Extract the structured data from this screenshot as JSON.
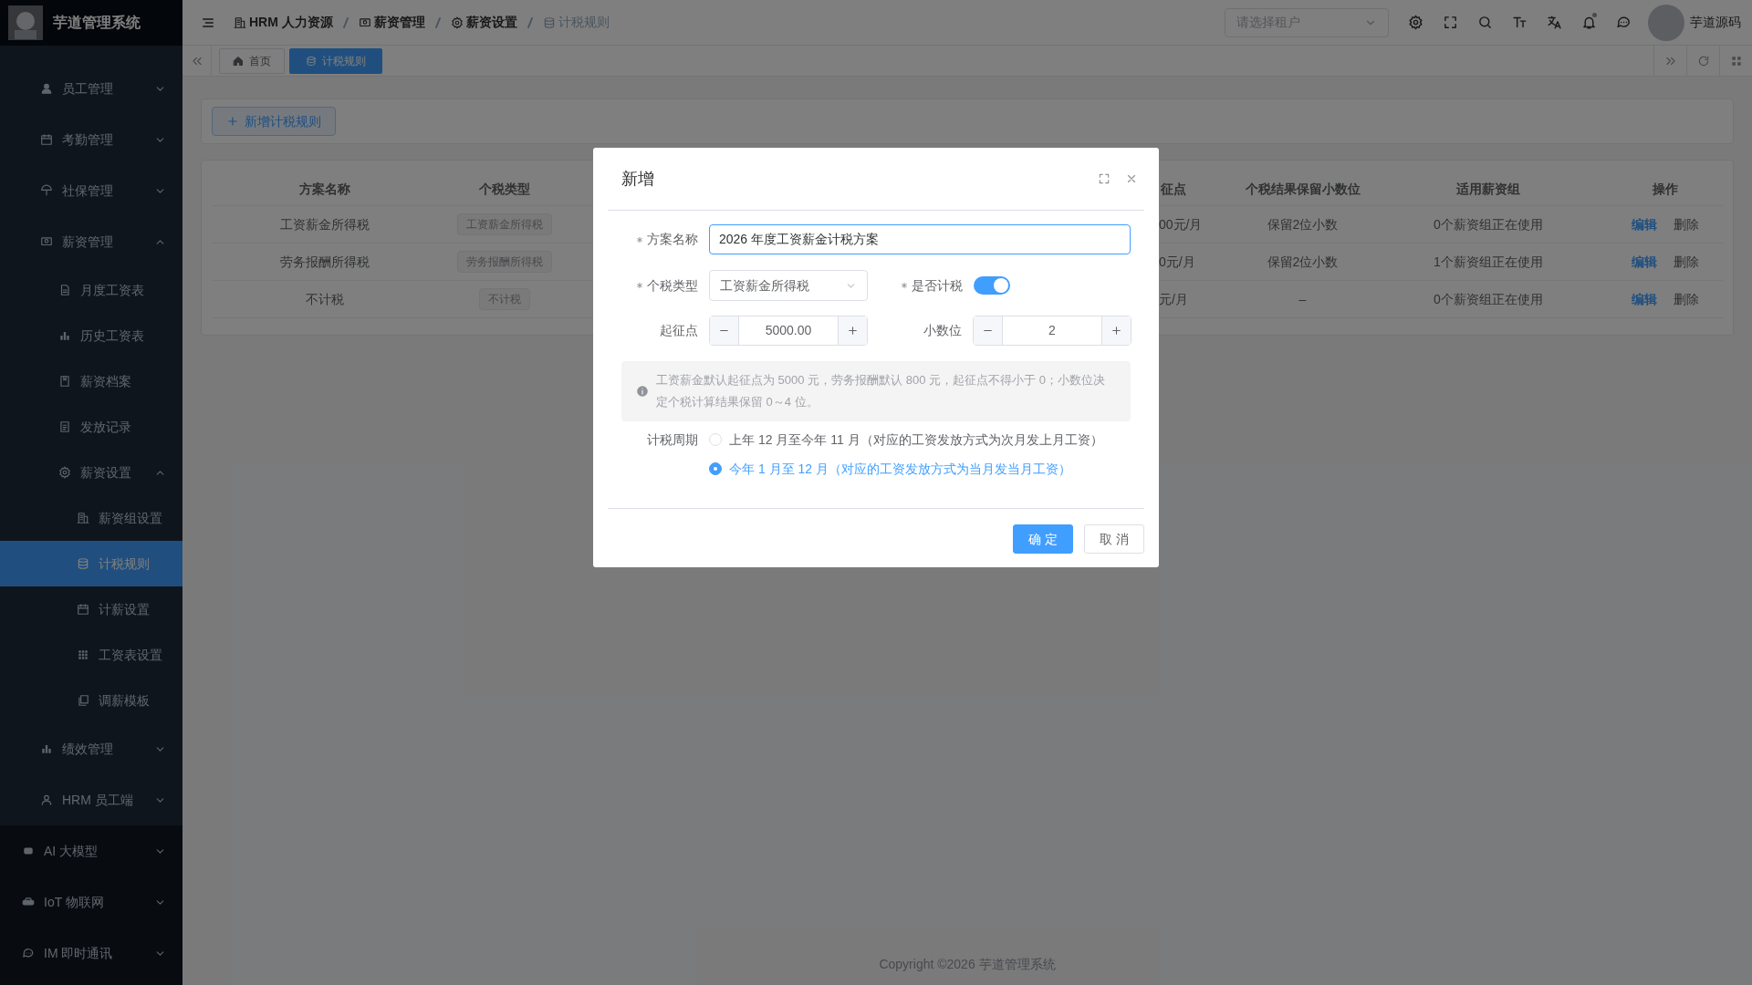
{
  "sidebar": {
    "logo_text": "芋道管理系统",
    "hrm_items": [
      {
        "label": "员工管理",
        "expanded": false,
        "selected": false
      },
      {
        "label": "考勤管理",
        "expanded": false,
        "selected": false
      },
      {
        "label": "社保管理",
        "expanded": false,
        "selected": false
      },
      {
        "label": "薪资管理",
        "expanded": true,
        "selected": false,
        "children": [
          {
            "label": "月度工资表",
            "selected": false
          },
          {
            "label": "历史工资表",
            "selected": false
          },
          {
            "label": "薪资档案",
            "selected": false
          },
          {
            "label": "发放记录",
            "selected": false
          },
          {
            "label": "薪资设置",
            "expanded": true,
            "selected": false,
            "children": [
              {
                "label": "薪资组设置",
                "selected": false
              },
              {
                "label": "计税规则",
                "selected": true
              },
              {
                "label": "计薪设置",
                "selected": false
              },
              {
                "label": "工资表设置",
                "selected": false
              },
              {
                "label": "调薪模板",
                "selected": false
              }
            ]
          }
        ]
      },
      {
        "label": "绩效管理",
        "expanded": false,
        "selected": false
      },
      {
        "label": "HRM 员工端",
        "expanded": false,
        "selected": false
      }
    ],
    "modules": [
      {
        "label": "AI 大模型",
        "expanded": false,
        "selected": false
      },
      {
        "label": "IoT 物联网",
        "expanded": false,
        "selected": false
      },
      {
        "label": "IM 即时通讯",
        "expanded": false,
        "selected": false
      }
    ]
  },
  "header": {
    "breadcrumb": [
      {
        "label": "HRM 人力资源",
        "current": false
      },
      {
        "label": "薪资管理",
        "current": false
      },
      {
        "label": "薪资设置",
        "current": false
      },
      {
        "label": "计税规则",
        "current": true
      }
    ],
    "tenant_select": {
      "placeholder": "请选择租户"
    },
    "notifications_unread": true,
    "user_name": "芋道源码"
  },
  "tabs": [
    {
      "label": "首页",
      "selected": false
    },
    {
      "label": "计税规则",
      "selected": true
    }
  ],
  "toolbar": {
    "add_button": "新增计税规则"
  },
  "table": {
    "columns": [
      "方案名称",
      "个税类型",
      "征点",
      "个税结果保留小数位",
      "适用薪资组",
      "操作"
    ],
    "rows": [
      {
        "name": "工资薪金所得税",
        "tax_type": "工资薪金所得税",
        "threshold": "00元/月",
        "decimals": "保留2位小数",
        "groups": "0个薪资组正在使用",
        "actions": [
          "编辑",
          "删除"
        ]
      },
      {
        "name": "劳务报酬所得税",
        "tax_type": "劳务报酬所得税",
        "threshold": "0元/月",
        "decimals": "保留2位小数",
        "groups": "1个薪资组正在使用",
        "actions": [
          "编辑",
          "删除"
        ]
      },
      {
        "name": "不计税",
        "tax_type": "不计税",
        "threshold": "元/月",
        "decimals": "–",
        "groups": "0个薪资组正在使用",
        "actions": [
          "编辑",
          "删除"
        ]
      }
    ]
  },
  "footer": "Copyright ©2026 芋道管理系统",
  "modal": {
    "title": "新增",
    "plan_name": {
      "label": "方案名称",
      "required": true,
      "value": "2026 年度工资薪金计税方案"
    },
    "tax_type": {
      "label": "个税类型",
      "required": true,
      "value": "工资薪金所得税"
    },
    "taxable": {
      "label": "是否计税",
      "required": true,
      "on": true
    },
    "threshold": {
      "label": "起征点",
      "required": false,
      "value": "5000.00"
    },
    "decimals": {
      "label": "小数位",
      "required": false,
      "value": "2"
    },
    "hint": "工资薪金默认起征点为 5000 元，劳务报酬默认 800 元，起征点不得小于 0；小数位决定个税计算结果保留 0～4 位。",
    "period": {
      "label": "计税周期",
      "options": [
        {
          "label": "上年 12 月至今年 11 月（对应的工资发放方式为次月发上月工资）",
          "selected": false
        },
        {
          "label": "今年 1 月至 12 月（对应的工资发放方式为当月发当月工资）",
          "selected": true
        }
      ]
    },
    "buttons": [
      {
        "label": "确 定",
        "kind": "primary"
      },
      {
        "label": "取 消",
        "kind": "default"
      }
    ]
  }
}
